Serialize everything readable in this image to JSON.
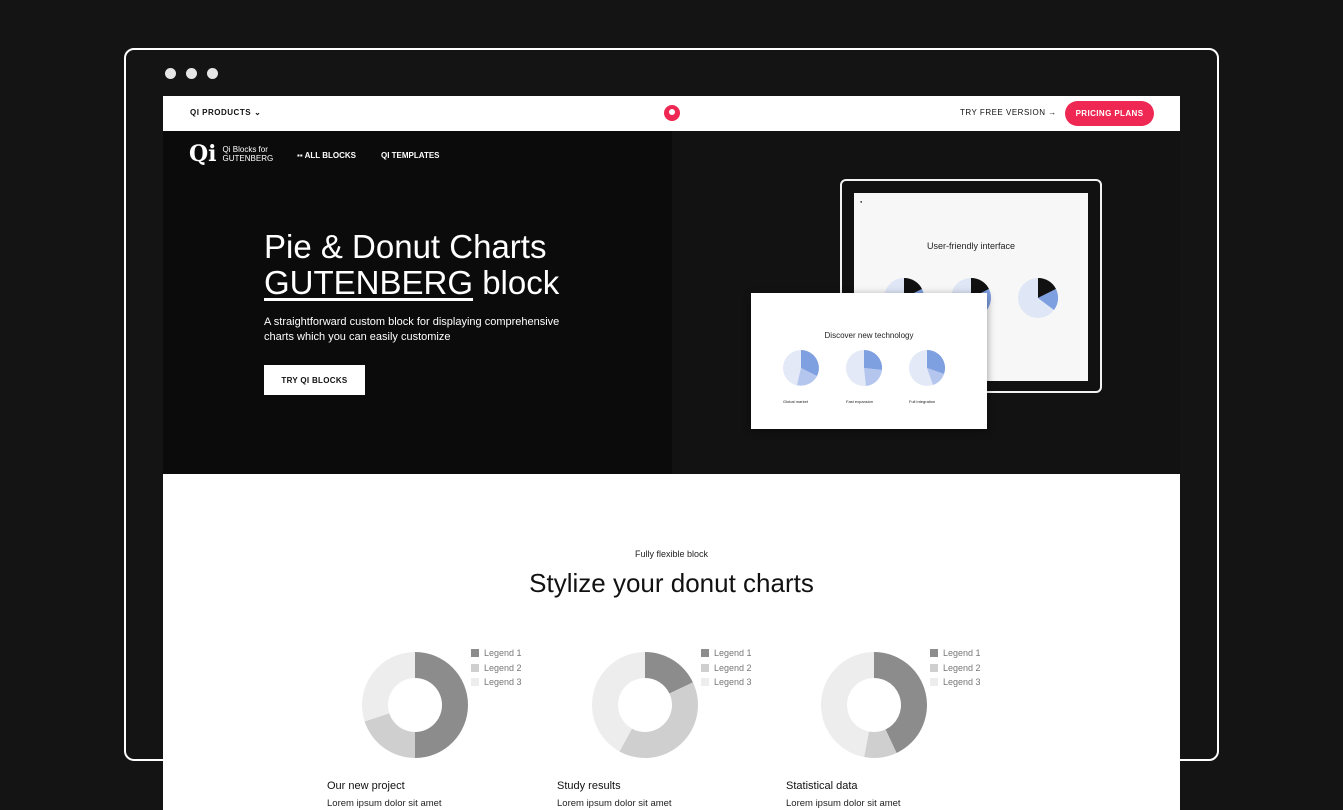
{
  "topbar": {
    "products": "QI PRODUCTS",
    "try_free": "TRY FREE VERSION →",
    "pricing": "PRICING PLANS"
  },
  "hero": {
    "brand_mark": "Qi",
    "brand_line1": "Qi Blocks for",
    "brand_line2": "GUTENBERG",
    "nav_all_blocks": "ALL BLOCKS",
    "nav_templates": "QI TEMPLATES",
    "title_line1": "Pie & Donut Charts",
    "title_underlined": "GUTENBERG",
    "title_rest": " block",
    "subtitle": "A straightforward custom block for displaying comprehensive charts which you can easily customize",
    "cta": "TRY QI BLOCKS",
    "tablet_title": "User-friendly interface",
    "laptop_title": "Discover new technology",
    "laptop_captions": [
      "Global market",
      "Fast expansion",
      "Full integration"
    ]
  },
  "section": {
    "eyebrow": "Fully flexible block",
    "title": "Stylize your donut charts"
  },
  "colors": {
    "accent": "#ee2852",
    "slice1": "#8c8c8c",
    "slice2": "#cfcfcf",
    "slice3": "#ededed"
  },
  "cards": [
    {
      "title": "Our new project",
      "desc": "Lorem ipsum dolor sit amet",
      "legend": [
        "Legend 1",
        "Legend 2",
        "Legend 3"
      ],
      "values": [
        50,
        20,
        30
      ]
    },
    {
      "title": "Study results",
      "desc": "Lorem ipsum dolor sit amet",
      "legend": [
        "Legend 1",
        "Legend 2",
        "Legend 3"
      ],
      "values": [
        18,
        40,
        42
      ]
    },
    {
      "title": "Statistical data",
      "desc": "Lorem ipsum dolor sit amet",
      "legend": [
        "Legend 1",
        "Legend 2",
        "Legend 3"
      ],
      "values": [
        43,
        10,
        47
      ]
    }
  ]
}
